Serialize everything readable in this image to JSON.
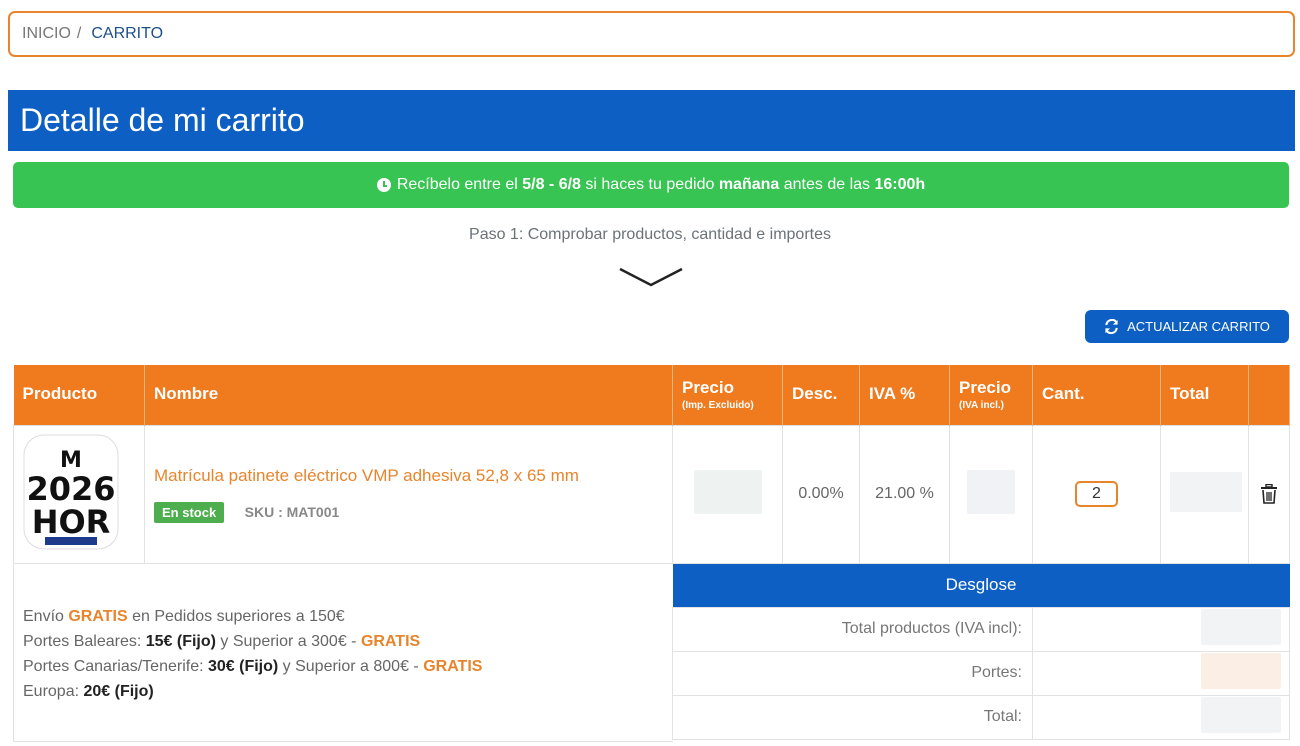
{
  "breadcrumb": {
    "home": "INICIO",
    "separator": "/",
    "current": "CARRITO"
  },
  "page": {
    "title": "Detalle de mi carrito"
  },
  "delivery": {
    "prefix": "Recíbelo entre el",
    "dates": "5/8 - 6/8",
    "middle": "si haces tu pedido",
    "day": "mañana",
    "before": "antes de las",
    "time": "16:00h"
  },
  "step": {
    "text": "Paso 1: Comprobar productos, cantidad e importes"
  },
  "update_button": {
    "label": "ACTUALIZAR CARRITO"
  },
  "table": {
    "headers": {
      "product": "Producto",
      "name": "Nombre",
      "price_excl": "Precio",
      "price_excl_sub": "(Imp. Excluido)",
      "discount": "Desc.",
      "vat": "IVA %",
      "price_incl": "Precio",
      "price_incl_sub": "(IVA incl.)",
      "qty": "Cant.",
      "total": "Total"
    },
    "rows": [
      {
        "image_text_top": "M",
        "image_text_mid": "2026",
        "image_text_bot": "HOR",
        "name": "Matrícula patinete eléctrico VMP adhesiva 52,8 x 65 mm",
        "stock": "En stock",
        "sku": "SKU : MAT001",
        "discount": "0.00%",
        "vat": "21.00 %",
        "qty": "2"
      }
    ]
  },
  "shipping": {
    "line1_a": "Envío ",
    "line1_b": "GRATIS",
    "line1_c": " en Pedidos superiores a 150€",
    "line2_a": "Portes Baleares: ",
    "line2_b": "15€ (Fijo)",
    "line2_c": " y Superior a 300€ - ",
    "line2_d": "GRATIS",
    "line3_a": "Portes Canarias/Tenerife: ",
    "line3_b": "30€ (Fijo)",
    "line3_c": " y Superior a 800€ - ",
    "line3_d": "GRATIS",
    "line4_a": "Europa: ",
    "line4_b": "20€ (Fijo)"
  },
  "summary": {
    "title": "Desglose",
    "total_products": "Total productos (IVA incl):",
    "shipping": "Portes:",
    "total": "Total:"
  },
  "colors": {
    "orange": "#f07b1f",
    "blue": "#0e5fc3",
    "green": "#37c452"
  }
}
